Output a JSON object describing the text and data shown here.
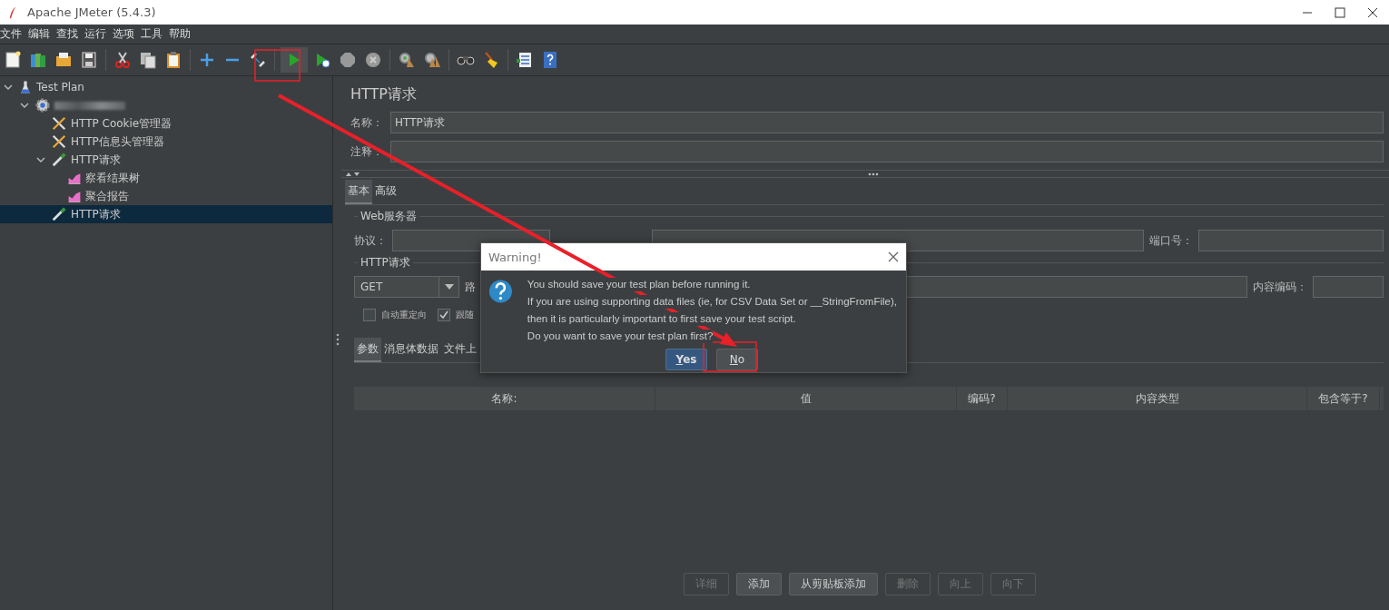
{
  "window": {
    "title": "Apache JMeter (5.4.3)"
  },
  "menu": [
    "文件",
    "编辑",
    "查找",
    "运行",
    "选项",
    "工具",
    "帮助"
  ],
  "tree": [
    {
      "label": "Test Plan",
      "kind": "plan",
      "expanded": true,
      "selected": false,
      "children": [
        {
          "kind": "thread_group",
          "redacted": true,
          "expanded": true,
          "selected": false,
          "children": [
            {
              "label": "HTTP Cookie管理器",
              "kind": "config",
              "selected": false
            },
            {
              "label": "HTTP信息头管理器",
              "kind": "config",
              "selected": false
            },
            {
              "label": "HTTP请求",
              "kind": "sampler",
              "expanded": true,
              "selected": false,
              "children": [
                {
                  "label": "察看结果树",
                  "kind": "listener",
                  "selected": false
                },
                {
                  "label": "聚合报告",
                  "kind": "listener",
                  "selected": false
                }
              ]
            },
            {
              "label": "HTTP请求",
              "kind": "sampler",
              "selected": true
            }
          ]
        }
      ]
    }
  ],
  "editor": {
    "title": "HTTP请求",
    "name_label": "名称：",
    "name_value": "HTTP请求",
    "comment_label": "注释：",
    "tabs": [
      {
        "label": "基本",
        "selected": true
      },
      {
        "label": "高级",
        "selected": false
      }
    ],
    "web_server": {
      "legend": "Web服务器",
      "protocol_label": "协议：",
      "port_label": "端口号："
    },
    "http_request": {
      "legend": "HTTP请求",
      "method": "GET",
      "path_label": "路",
      "encoding_label": "内容编码：",
      "options": [
        {
          "label": "自动重定向",
          "checked": false
        },
        {
          "label": "跟随",
          "checked": true
        }
      ]
    },
    "param_tabs": [
      {
        "label": "参数",
        "selected": true
      },
      {
        "label": "消息体数据",
        "selected": false
      },
      {
        "label": "文件上",
        "selected": false
      }
    ],
    "table": {
      "columns": [
        "名称:",
        "值",
        "编码?",
        "内容类型",
        "包含等于?"
      ]
    },
    "buttons": [
      {
        "label": "详细",
        "disabled": true
      },
      {
        "label": "添加",
        "disabled": false
      },
      {
        "label": "从剪贴板添加",
        "disabled": false
      },
      {
        "label": "删除",
        "disabled": true
      },
      {
        "label": "向上",
        "disabled": true
      },
      {
        "label": "向下",
        "disabled": true
      }
    ]
  },
  "dialog": {
    "title": "Warning!",
    "lines": [
      "You should save your test plan before running it.",
      "If you are using supporting data files (ie, for CSV Data Set or __StringFromFile),",
      "then it is particularly important to first save your test script.",
      "Do you want to save your test plan first?"
    ],
    "buttons": [
      {
        "label": "Yes",
        "selected": true
      },
      {
        "label": "No",
        "selected": false
      }
    ]
  }
}
